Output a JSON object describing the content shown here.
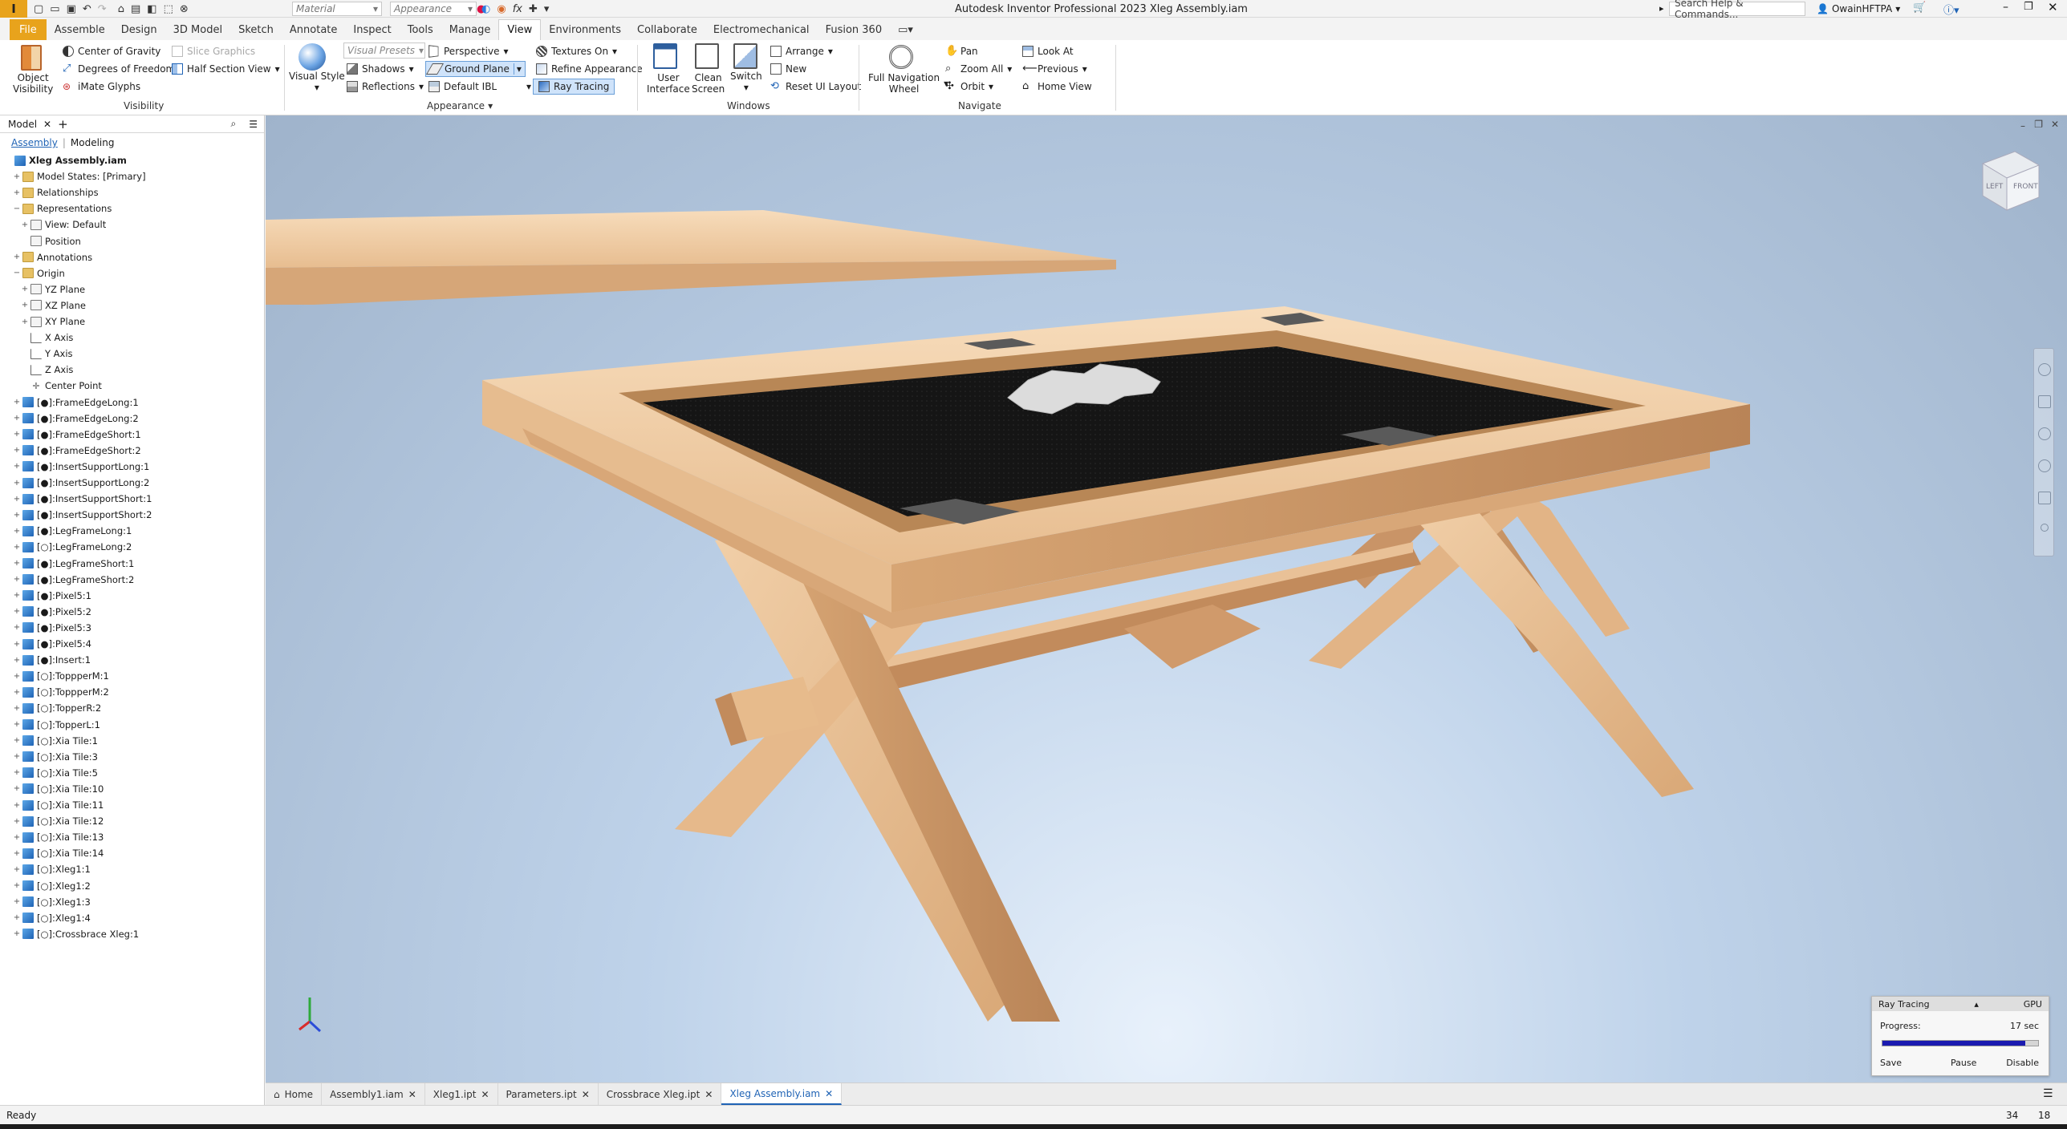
{
  "titlebar": {
    "window_title": "Autodesk Inventor Professional 2023   Xleg Assembly.iam",
    "material_placeholder": "Material",
    "appearance_placeholder": "Appearance",
    "search_placeholder": "Search Help & Commands...",
    "user": "OwainHFTPA"
  },
  "tabs": [
    "File",
    "Assemble",
    "Design",
    "3D Model",
    "Sketch",
    "Annotate",
    "Inspect",
    "Tools",
    "Manage",
    "View",
    "Environments",
    "Collaborate",
    "Electromechanical",
    "Fusion 360"
  ],
  "active_tab": "View",
  "ribbon": {
    "visibility": {
      "object_visibility": "Object\nVisibility",
      "center_of_gravity": "Center of Gravity",
      "degrees_of_freedom": "Degrees of Freedom",
      "imate_glyphs": "iMate Glyphs",
      "slice_graphics": "Slice Graphics",
      "half_section_view": "Half Section View",
      "panel_label": "Visibility"
    },
    "appearance": {
      "visual_style": "Visual Style",
      "visual_presets": "Visual Presets",
      "shadows": "Shadows",
      "reflections": "Reflections",
      "perspective": "Perspective",
      "ground_plane": "Ground Plane",
      "default_ibl": "Default IBL",
      "textures_on": "Textures On",
      "refine_appearance": "Refine Appearance",
      "ray_tracing": "Ray Tracing",
      "panel_label": "Appearance"
    },
    "windows": {
      "user_interface": "User\nInterface",
      "clean_screen": "Clean\nScreen",
      "switch": "Switch",
      "arrange": "Arrange",
      "new": "New",
      "reset_ui_layout": "Reset UI Layout",
      "panel_label": "Windows"
    },
    "navigate": {
      "full_navigation_wheel": "Full Navigation\nWheel",
      "pan": "Pan",
      "zoom_all": "Zoom All",
      "orbit": "Orbit",
      "look_at": "Look At",
      "previous": "Previous",
      "home_view": "Home View",
      "panel_label": "Navigate"
    }
  },
  "browser": {
    "title": "Model",
    "tab_assembly": "Assembly",
    "tab_modeling": "Modeling",
    "items": [
      {
        "label": "Xleg Assembly.iam",
        "level": 0,
        "icon": "part",
        "toggle": "",
        "bold": true
      },
      {
        "label": "Model States: [Primary]",
        "level": 1,
        "icon": "folder",
        "toggle": "+"
      },
      {
        "label": "Relationships",
        "level": 1,
        "icon": "folder",
        "toggle": "+"
      },
      {
        "label": "Representations",
        "level": 1,
        "icon": "folder",
        "toggle": "−"
      },
      {
        "label": "View: Default",
        "level": 2,
        "icon": "plane",
        "toggle": "+"
      },
      {
        "label": "Position",
        "level": 2,
        "icon": "plane",
        "toggle": ""
      },
      {
        "label": "Annotations",
        "level": 1,
        "icon": "folder",
        "toggle": "+"
      },
      {
        "label": "Origin",
        "level": 1,
        "icon": "folder",
        "toggle": "−"
      },
      {
        "label": "YZ Plane",
        "level": 2,
        "icon": "plane",
        "toggle": "+"
      },
      {
        "label": "XZ Plane",
        "level": 2,
        "icon": "plane",
        "toggle": "+"
      },
      {
        "label": "XY Plane",
        "level": 2,
        "icon": "plane",
        "toggle": "+"
      },
      {
        "label": "X Axis",
        "level": 2,
        "icon": "axis",
        "toggle": ""
      },
      {
        "label": "Y Axis",
        "level": 2,
        "icon": "axis",
        "toggle": ""
      },
      {
        "label": "Z Axis",
        "level": 2,
        "icon": "axis",
        "toggle": ""
      },
      {
        "label": "Center Point",
        "level": 2,
        "icon": "pt",
        "toggle": ""
      },
      {
        "label": "[●]:FrameEdgeLong:1",
        "level": 1,
        "icon": "part",
        "toggle": "+"
      },
      {
        "label": "[●]:FrameEdgeLong:2",
        "level": 1,
        "icon": "part",
        "toggle": "+"
      },
      {
        "label": "[●]:FrameEdgeShort:1",
        "level": 1,
        "icon": "part",
        "toggle": "+"
      },
      {
        "label": "[●]:FrameEdgeShort:2",
        "level": 1,
        "icon": "part",
        "toggle": "+"
      },
      {
        "label": "[●]:InsertSupportLong:1",
        "level": 1,
        "icon": "part",
        "toggle": "+"
      },
      {
        "label": "[●]:InsertSupportLong:2",
        "level": 1,
        "icon": "part",
        "toggle": "+"
      },
      {
        "label": "[●]:InsertSupportShort:1",
        "level": 1,
        "icon": "part",
        "toggle": "+"
      },
      {
        "label": "[●]:InsertSupportShort:2",
        "level": 1,
        "icon": "part",
        "toggle": "+"
      },
      {
        "label": "[●]:LegFrameLong:1",
        "level": 1,
        "icon": "part",
        "toggle": "+"
      },
      {
        "label": "[○]:LegFrameLong:2",
        "level": 1,
        "icon": "part",
        "toggle": "+"
      },
      {
        "label": "[●]:LegFrameShort:1",
        "level": 1,
        "icon": "part",
        "toggle": "+"
      },
      {
        "label": "[●]:LegFrameShort:2",
        "level": 1,
        "icon": "part",
        "toggle": "+"
      },
      {
        "label": "[●]:Pixel5:1",
        "level": 1,
        "icon": "part",
        "toggle": "+"
      },
      {
        "label": "[●]:Pixel5:2",
        "level": 1,
        "icon": "part",
        "toggle": "+"
      },
      {
        "label": "[●]:Pixel5:3",
        "level": 1,
        "icon": "part",
        "toggle": "+"
      },
      {
        "label": "[●]:Pixel5:4",
        "level": 1,
        "icon": "part",
        "toggle": "+"
      },
      {
        "label": "[●]:Insert:1",
        "level": 1,
        "icon": "part",
        "toggle": "+"
      },
      {
        "label": "[○]:ToppperM:1",
        "level": 1,
        "icon": "part",
        "toggle": "+"
      },
      {
        "label": "[○]:ToppperM:2",
        "level": 1,
        "icon": "part",
        "toggle": "+"
      },
      {
        "label": "[○]:TopperR:2",
        "level": 1,
        "icon": "part",
        "toggle": "+"
      },
      {
        "label": "[○]:TopperL:1",
        "level": 1,
        "icon": "part",
        "toggle": "+"
      },
      {
        "label": "[○]:Xia Tile:1",
        "level": 1,
        "icon": "part",
        "toggle": "+"
      },
      {
        "label": "[○]:Xia Tile:3",
        "level": 1,
        "icon": "part",
        "toggle": "+"
      },
      {
        "label": "[○]:Xia Tile:5",
        "level": 1,
        "icon": "part",
        "toggle": "+"
      },
      {
        "label": "[○]:Xia Tile:10",
        "level": 1,
        "icon": "part",
        "toggle": "+"
      },
      {
        "label": "[○]:Xia Tile:11",
        "level": 1,
        "icon": "part",
        "toggle": "+"
      },
      {
        "label": "[○]:Xia Tile:12",
        "level": 1,
        "icon": "part",
        "toggle": "+"
      },
      {
        "label": "[○]:Xia Tile:13",
        "level": 1,
        "icon": "part",
        "toggle": "+"
      },
      {
        "label": "[○]:Xia Tile:14",
        "level": 1,
        "icon": "part",
        "toggle": "+"
      },
      {
        "label": "[○]:Xleg1:1",
        "level": 1,
        "icon": "part",
        "toggle": "+"
      },
      {
        "label": "[○]:Xleg1:2",
        "level": 1,
        "icon": "part",
        "toggle": "+"
      },
      {
        "label": "[○]:Xleg1:3",
        "level": 1,
        "icon": "part",
        "toggle": "+"
      },
      {
        "label": "[○]:Xleg1:4",
        "level": 1,
        "icon": "part",
        "toggle": "+"
      },
      {
        "label": "[○]:Crossbrace Xleg:1",
        "level": 1,
        "icon": "part",
        "toggle": "+"
      }
    ]
  },
  "doc_tabs": [
    {
      "label": "Home",
      "active": false
    },
    {
      "label": "Assembly1.iam",
      "active": false
    },
    {
      "label": "Xleg1.ipt",
      "active": false
    },
    {
      "label": "Parameters.ipt",
      "active": false
    },
    {
      "label": "Crossbrace Xleg.ipt",
      "active": false
    },
    {
      "label": "Xleg Assembly.iam",
      "active": true
    }
  ],
  "ray_tracing": {
    "title": "Ray Tracing",
    "mode": "GPU",
    "progress_label": "Progress:",
    "time": "17 sec",
    "progress": 0.92,
    "save": "Save",
    "pause": "Pause",
    "disable": "Disable"
  },
  "viewcube": {
    "left": "LEFT",
    "front": "FRONT"
  },
  "status": {
    "text": "Ready",
    "num1": "34",
    "num2": "18"
  },
  "colors": {
    "accent": "#e8a31c",
    "selection": "#1f63b5",
    "wood": "#e9bf95",
    "felt": "#141414"
  }
}
